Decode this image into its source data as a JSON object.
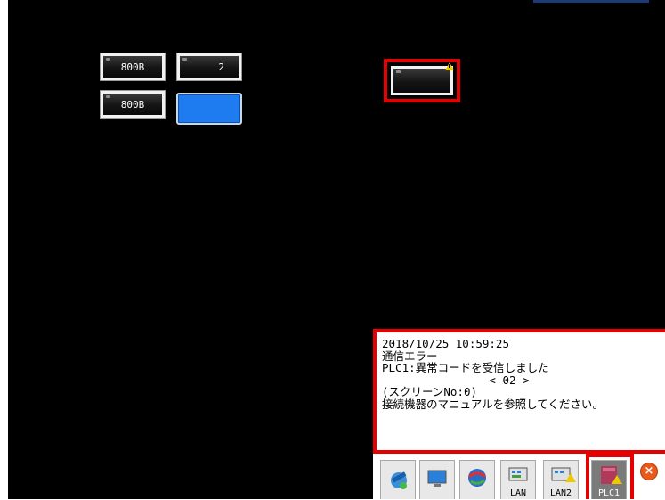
{
  "hmi": {
    "buttons": {
      "b1": "800B",
      "b2": "2",
      "b3": "800B"
    }
  },
  "error_message": {
    "lines": [
      "2018/10/25 10:59:25",
      "通信エラー",
      "PLC1:異常コードを受信しました",
      "                < 02 >",
      "(スクリーンNo:0)",
      "接続機器のマニュアルを参照してください。"
    ]
  },
  "taskbar": {
    "items": [
      {
        "icon": "satellite-icon",
        "label": ""
      },
      {
        "icon": "monitor-icon",
        "label": ""
      },
      {
        "icon": "globe-icon",
        "label": ""
      },
      {
        "icon": "lan-icon",
        "label": "LAN"
      },
      {
        "icon": "lan-warning-icon",
        "label": "LAN2"
      },
      {
        "icon": "plc-warning-icon",
        "label": "PLC1"
      }
    ],
    "close_icon": "close-icon"
  },
  "colors": {
    "background": "#000000",
    "highlight": "#e60000",
    "blue_button": "#1e7cf0",
    "warning": "#f0c800"
  }
}
